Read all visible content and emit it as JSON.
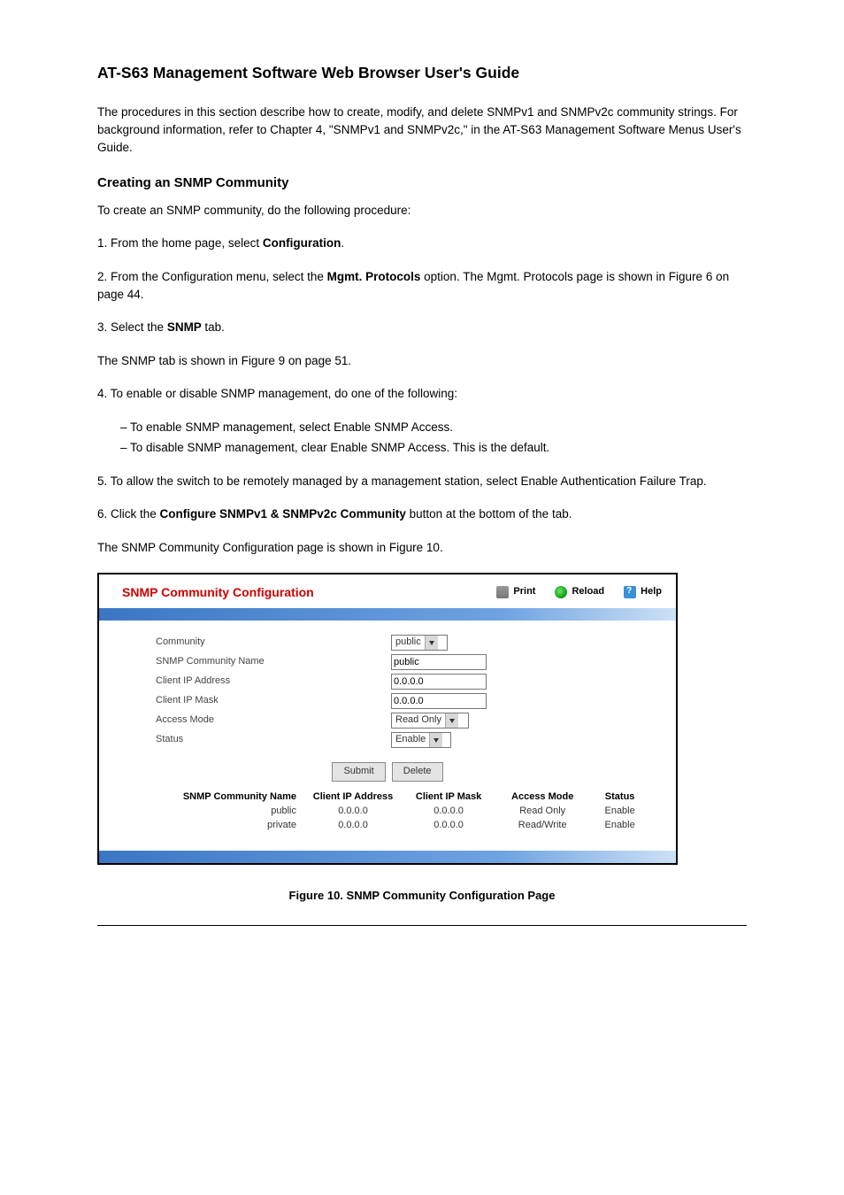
{
  "page_title": "AT-S63 Management Software Web Browser User's Guide",
  "intro": "The procedures in this section describe how to create, modify, and delete SNMPv1 and SNMPv2c community strings. For background information, refer to Chapter 4, \"SNMPv1 and SNMPv2c,\" in the AT-S63 Management Software Menus User's Guide.",
  "creating_heading": "Creating an SNMP Community",
  "creating_intro": "To create an SNMP community, do the following procedure:",
  "step1_lead": "1. From the home page, select ",
  "step1_config": "Configuration",
  "step1_p_a": "2. From the Configuration menu, select the ",
  "step1_mgmt": "Mgmt. Protocols ",
  "step1_p_b": "option. The Mgmt. Protocols page is shown in Figure 6 on page 44.",
  "step3_p_a": "3. Select the ",
  "step3_snmp": "SNMP ",
  "step3_p_b": "tab.",
  "step3_after": "The SNMP tab is shown in Figure 9 on page 51.",
  "step4": "4. To enable or disable SNMP management, do one of the following:",
  "step4_a": "– To enable SNMP management, select Enable SNMP Access.",
  "step4_b": "– To disable SNMP management, clear Enable SNMP Access. This is the default.",
  "step5": "5. To allow the switch to be remotely managed by a management station, select Enable Authentication Failure Trap.",
  "step6_a": "6. Click the ",
  "step6_configure": "Configure SNMPv1 & SNMPv2c Community",
  "step6_b": " button at the bottom of the tab.",
  "step6_after": "The SNMP Community Configuration page is shown in Figure 10.",
  "screenshot": {
    "title": "SNMP Community Configuration",
    "print": "Print",
    "reload": "Reload",
    "help": "Help",
    "labels": {
      "community": "Community",
      "snmp_name": "SNMP Community Name",
      "client_ip": "Client IP Address",
      "client_mask": "Client IP Mask",
      "access_mode": "Access Mode",
      "status": "Status"
    },
    "fields": {
      "community_sel": "public",
      "snmp_name": "public",
      "client_ip": "0.0.0.0",
      "client_mask": "0.0.0.0",
      "access_mode_sel": "Read Only",
      "status_sel": "Enable"
    },
    "buttons": {
      "submit": "Submit",
      "delete": "Delete"
    },
    "table": {
      "head": {
        "c1": "SNMP Community Name",
        "c2": "Client IP Address",
        "c3": "Client IP Mask",
        "c4": "Access Mode",
        "c5": "Status"
      },
      "rows": [
        {
          "c1": "public",
          "c2": "0.0.0.0",
          "c3": "0.0.0.0",
          "c4": "Read Only",
          "c5": "Enable"
        },
        {
          "c1": "private",
          "c2": "0.0.0.0",
          "c3": "0.0.0.0",
          "c4": "Read/Write",
          "c5": "Enable"
        }
      ]
    }
  },
  "figure_caption": "Figure 10. SNMP Community Configuration Page"
}
